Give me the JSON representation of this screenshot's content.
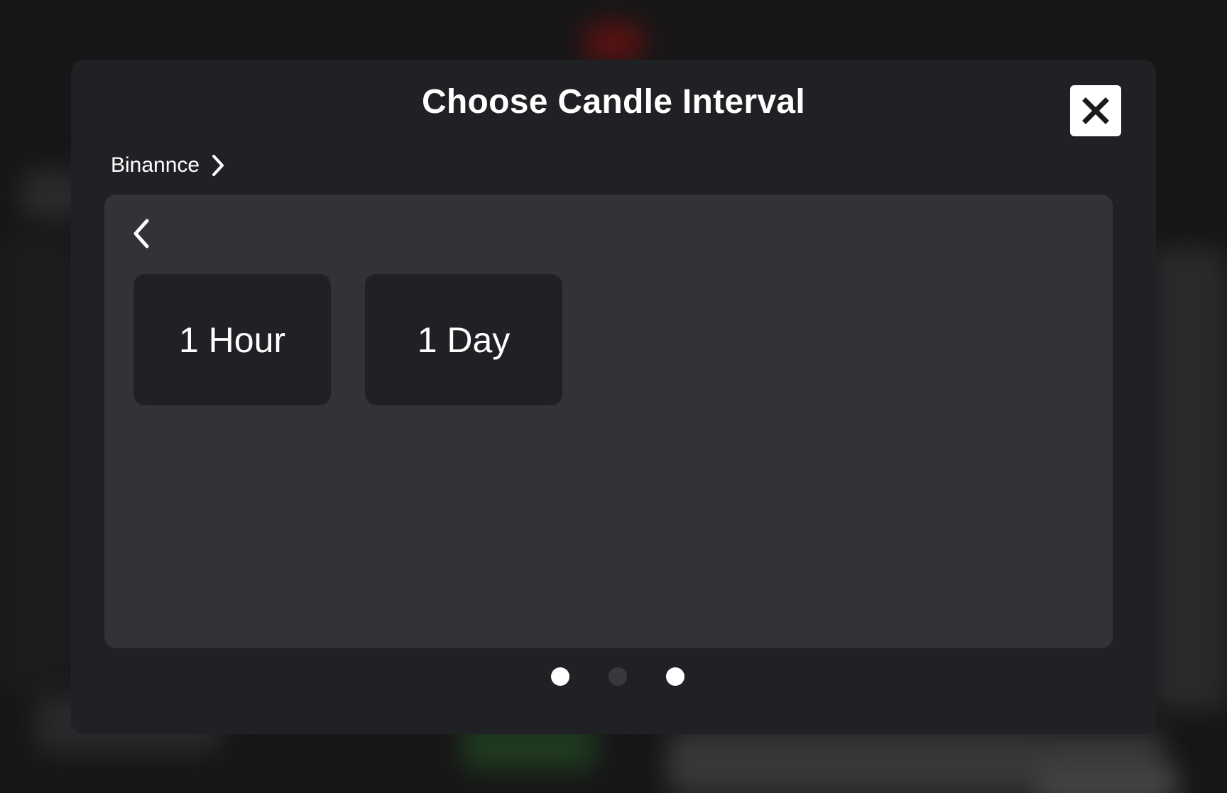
{
  "modal": {
    "title": "Choose Candle Interval",
    "close_icon": "close-icon"
  },
  "breadcrumb": {
    "label": "Binannce",
    "icon": "chevron-right-icon"
  },
  "panel": {
    "back_icon": "chevron-left-icon",
    "intervals": [
      {
        "label": "1 Hour"
      },
      {
        "label": "1 Day"
      }
    ]
  },
  "pagination": {
    "dots": [
      {
        "state": "active"
      },
      {
        "state": "inactive"
      },
      {
        "state": "active"
      }
    ]
  },
  "colors": {
    "modal_bg": "#202124",
    "panel_bg": "#323337",
    "card_bg": "#202124",
    "dot_active": "#ffffff",
    "dot_inactive": "#38393d"
  }
}
